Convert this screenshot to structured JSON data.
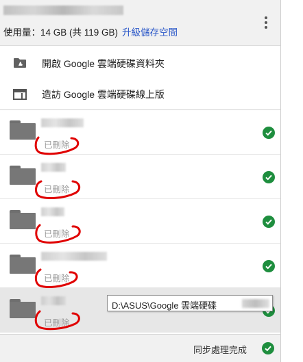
{
  "header": {
    "usage_label": "使用量：14 GB (共 119 GB)",
    "upgrade_label": "升級儲存空間",
    "menu_icon": "more-vert-icon"
  },
  "menu": [
    {
      "label": "開啟 Google 雲端硬碟資料夾",
      "icon": "drive-folder-icon"
    },
    {
      "label": "造訪 Google 雲端硬碟線上版",
      "icon": "browser-window-icon"
    }
  ],
  "files": [
    {
      "status": "已刪除"
    },
    {
      "status": "已刪除"
    },
    {
      "status": "已刪除"
    },
    {
      "status": "已刪除"
    },
    {
      "status": "已刪除"
    }
  ],
  "tooltip": {
    "path": "D:\\ASUS\\Google 雲端硬碟"
  },
  "footer": {
    "status": "同步處理完成"
  },
  "colors": {
    "accent": "#2a57c8",
    "success": "#1e8e3e",
    "annotation": "#e00000"
  }
}
